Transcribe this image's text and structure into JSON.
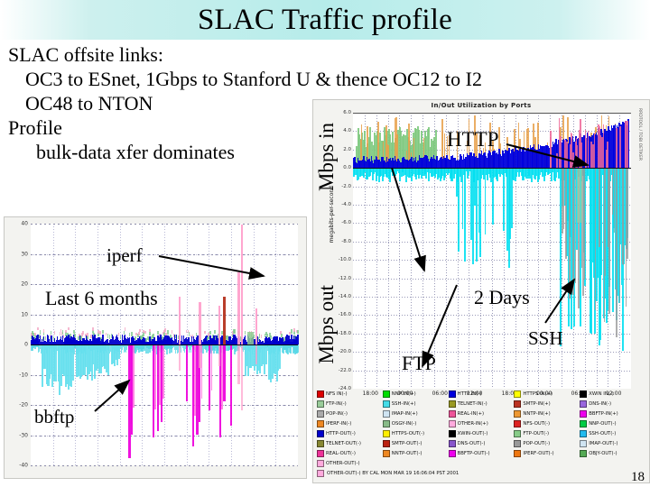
{
  "slide": {
    "title": "SLAC Traffic profile",
    "page_number": "18",
    "title_band_color": "#b6ecea"
  },
  "bullets": {
    "line1": "SLAC offsite links:",
    "line2": "OC3 to ESnet, 1Gbps to Stanford U & thence OC12 to I2",
    "line3": "OC48 to NTON",
    "line4": "Profile",
    "line5": "bulk-data xfer dominates"
  },
  "annotations": {
    "http": "HTTP",
    "two_days": "2 Days",
    "ftp": "FTP",
    "ssh": "SSH",
    "iperf": "iperf",
    "last_6_months": "Last 6 months",
    "bbftp": "bbftp"
  },
  "axis_captions": {
    "mbps_in": "Mbps in",
    "mbps_out": "Mbps out",
    "units_small": "megabits-per-second",
    "edge_text": "RRDTOOL / TOBI OETIKER"
  },
  "chart_data": [
    {
      "id": "left-chart",
      "type": "area",
      "title": "",
      "annotation": "Last 6 months",
      "xlabel": "",
      "ylabel": "Mbps",
      "ylim": [
        -40,
        40
      ],
      "yticks": [
        40,
        30,
        20,
        10,
        0,
        -10,
        -20,
        -30,
        -40
      ],
      "ytick_labels": [
        "40",
        "30",
        "20",
        "10",
        "0",
        "-10",
        "-20",
        "-30",
        "-40"
      ],
      "grid": true,
      "legend_position": "none",
      "series": [
        {
          "name": "iperf",
          "color": "#ff99cc",
          "peak": 40,
          "note": "tall pink spikes, max near +40 / -40"
        },
        {
          "name": "bbftp",
          "color": "#ff00cc",
          "peak": -38,
          "note": "magenta downward spikes to about -38"
        },
        {
          "name": "ssh-out",
          "color": "#66e0ee",
          "peak": -19,
          "note": "cyan out-traffic band to about -19"
        },
        {
          "name": "http-in",
          "color": "#0000cc",
          "peak": 3,
          "note": "dark blue baseline near zero"
        },
        {
          "name": "ftp-in",
          "color": "#66cc66",
          "peak": 4,
          "note": "green small positive"
        },
        {
          "name": "smtp",
          "color": "#cc3300",
          "peak": 16,
          "note": "dark red narrow spike"
        }
      ]
    },
    {
      "id": "right-chart",
      "type": "area",
      "title": "In/Out Utilization by Ports",
      "annotation": "2 Days",
      "xlabel": "",
      "ylabel": "Mbps",
      "ylim": [
        -24,
        6
      ],
      "yticks": [
        6,
        4,
        2,
        0,
        -2,
        -4,
        -6,
        -8,
        -10,
        -12,
        -14,
        -16,
        -18,
        -20,
        -22,
        -24
      ],
      "ytick_labels": [
        "6.0",
        "4.0",
        "2.0",
        "0.0",
        "-2.0",
        "-4.0",
        "-6.0",
        "-8.0",
        "-10.0",
        "-12.0",
        "-14.0",
        "-16.0",
        "-18.0",
        "-20.0",
        "-22.0",
        "-24.0"
      ],
      "xticks": [
        "18:00",
        "00:00",
        "06:00",
        "12:00",
        "18:00",
        "00:00",
        "06:00",
        "12:00"
      ],
      "grid": true,
      "legend_position": "bottom",
      "series": [
        {
          "name": "HTTP IN",
          "color": "#0000ee",
          "peak": 3.0,
          "note": "dark blue, rises toward right end"
        },
        {
          "name": "FTP IN",
          "color": "#66cc66",
          "peak": 5.0,
          "note": "green block on left third"
        },
        {
          "name": "SSH OUT",
          "color": "#00e5ee",
          "peak": -22.0,
          "note": "cyan downward, heavy on right"
        },
        {
          "name": "SMTP IN",
          "color": "#ee9944",
          "peak": 5.5,
          "note": "orange narrow spikes"
        },
        {
          "name": "REAL IN",
          "color": "#ee6699",
          "peak": 5.0,
          "note": "pink spikes near right"
        },
        {
          "name": "OTHER OUT",
          "color": "#999999",
          "peak": -20.0,
          "note": "grey downward spikes"
        }
      ]
    }
  ],
  "legend": {
    "items": [
      {
        "label": "NFS IN(-)",
        "color": "#dd0000"
      },
      {
        "label": "NNP IN(+)",
        "color": "#00dd00"
      },
      {
        "label": "HTTP IN(-)",
        "color": "#0000dd"
      },
      {
        "label": "HTTPS IN(+)",
        "color": "#ffff00"
      },
      {
        "label": "XWIN IN(-)",
        "color": "#000000"
      },
      {
        "label": "FTP-IN(-)",
        "color": "#99cc99"
      },
      {
        "label": "SSH-IN(+)",
        "color": "#44dde8"
      },
      {
        "label": "TELNET-IN(-)",
        "color": "#999922"
      },
      {
        "label": "SMTP-IN(+)",
        "color": "#bb3322"
      },
      {
        "label": "DNS-IN(-)",
        "color": "#9966dd"
      },
      {
        "label": "POP-IN(-)",
        "color": "#aaaaaa"
      },
      {
        "label": "IMAP-IN(+)",
        "color": "#cfe4f2"
      },
      {
        "label": "REAL-IN(+)",
        "color": "#ee5599"
      },
      {
        "label": "NNTP-IN(+)",
        "color": "#ee9933"
      },
      {
        "label": "BBFTP-IN(+)",
        "color": "#ee00ee"
      },
      {
        "label": "IPERF-IN(-)",
        "color": "#ee8822"
      },
      {
        "label": "OSGY-IN(-)",
        "color": "#88bb88"
      },
      {
        "label": "OTHER-IN(+)",
        "color": "#ffaadd"
      },
      {
        "label": "NFS-OUT(-)",
        "color": "#dd2222"
      },
      {
        "label": "NNP-OUT(-)",
        "color": "#00cc44"
      },
      {
        "label": "HTTP-OUT(-)",
        "color": "#0000cc"
      },
      {
        "label": "HTTPS-OUT(-)",
        "color": "#ffee00"
      },
      {
        "label": "XWIN-OUT(-)",
        "color": "#000000"
      },
      {
        "label": "FTP-OUT(-)",
        "color": "#88cc88"
      },
      {
        "label": "SSH-OUT(-)",
        "color": "#22bbee"
      },
      {
        "label": "TELNET-OUT(-)",
        "color": "#888833"
      },
      {
        "label": "SMTP-OUT(-)",
        "color": "#bb2211"
      },
      {
        "label": "DNS-OUT(-)",
        "color": "#8855cc"
      },
      {
        "label": "POP-OUT(-)",
        "color": "#999999"
      },
      {
        "label": "IMAP-OUT(-)",
        "color": "#cfe4f2"
      },
      {
        "label": "REAL-OUT(-)",
        "color": "#ee3399"
      },
      {
        "label": "NNTP-OUT(-)",
        "color": "#ee8822"
      },
      {
        "label": "BBFTP-OUT(-)",
        "color": "#ee00ee"
      },
      {
        "label": "IPERF-OUT(-)",
        "color": "#ee7711"
      },
      {
        "label": "OBJY-OUT(-)",
        "color": "#55aa55"
      },
      {
        "label": "OTHER-OUT(-)",
        "color": "#ffaadd"
      }
    ],
    "footer": "BY CAL  MON MAR 19 16:06:04 PST 2001"
  }
}
